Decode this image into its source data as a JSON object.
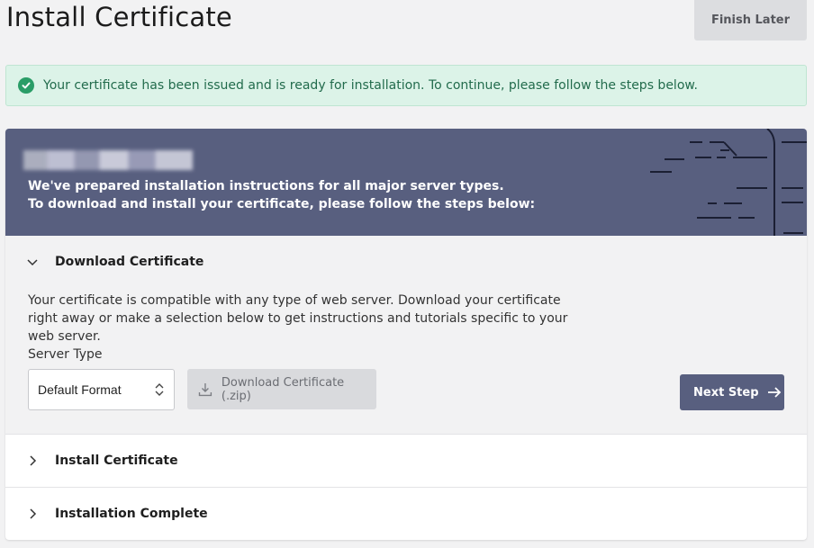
{
  "page": {
    "title": "Install Certificate"
  },
  "header": {
    "finish_later": "Finish Later"
  },
  "alert": {
    "message": "Your certificate has been issued and is ready for installation. To continue, please follow the steps below.",
    "icon": "check-circle-icon",
    "color": "#2a9d67"
  },
  "banner": {
    "line1": "We've prepared installation instructions for all major server types.",
    "line2": "To download and install your certificate, please follow the steps below:",
    "color": "#585f7f"
  },
  "steps": [
    {
      "title": "Download Certificate",
      "expanded": true,
      "description": "Your certificate is compatible with any type of web server. Download your certificate right away or make a selection below to get instructions and tutorials specific to your web server.",
      "server_type_label": "Server Type",
      "server_type_value": "Default Format",
      "download_label": "Download Certificate (.zip)",
      "next_label": "Next Step"
    },
    {
      "title": "Install Certificate",
      "expanded": false
    },
    {
      "title": "Installation Complete",
      "expanded": false
    }
  ]
}
